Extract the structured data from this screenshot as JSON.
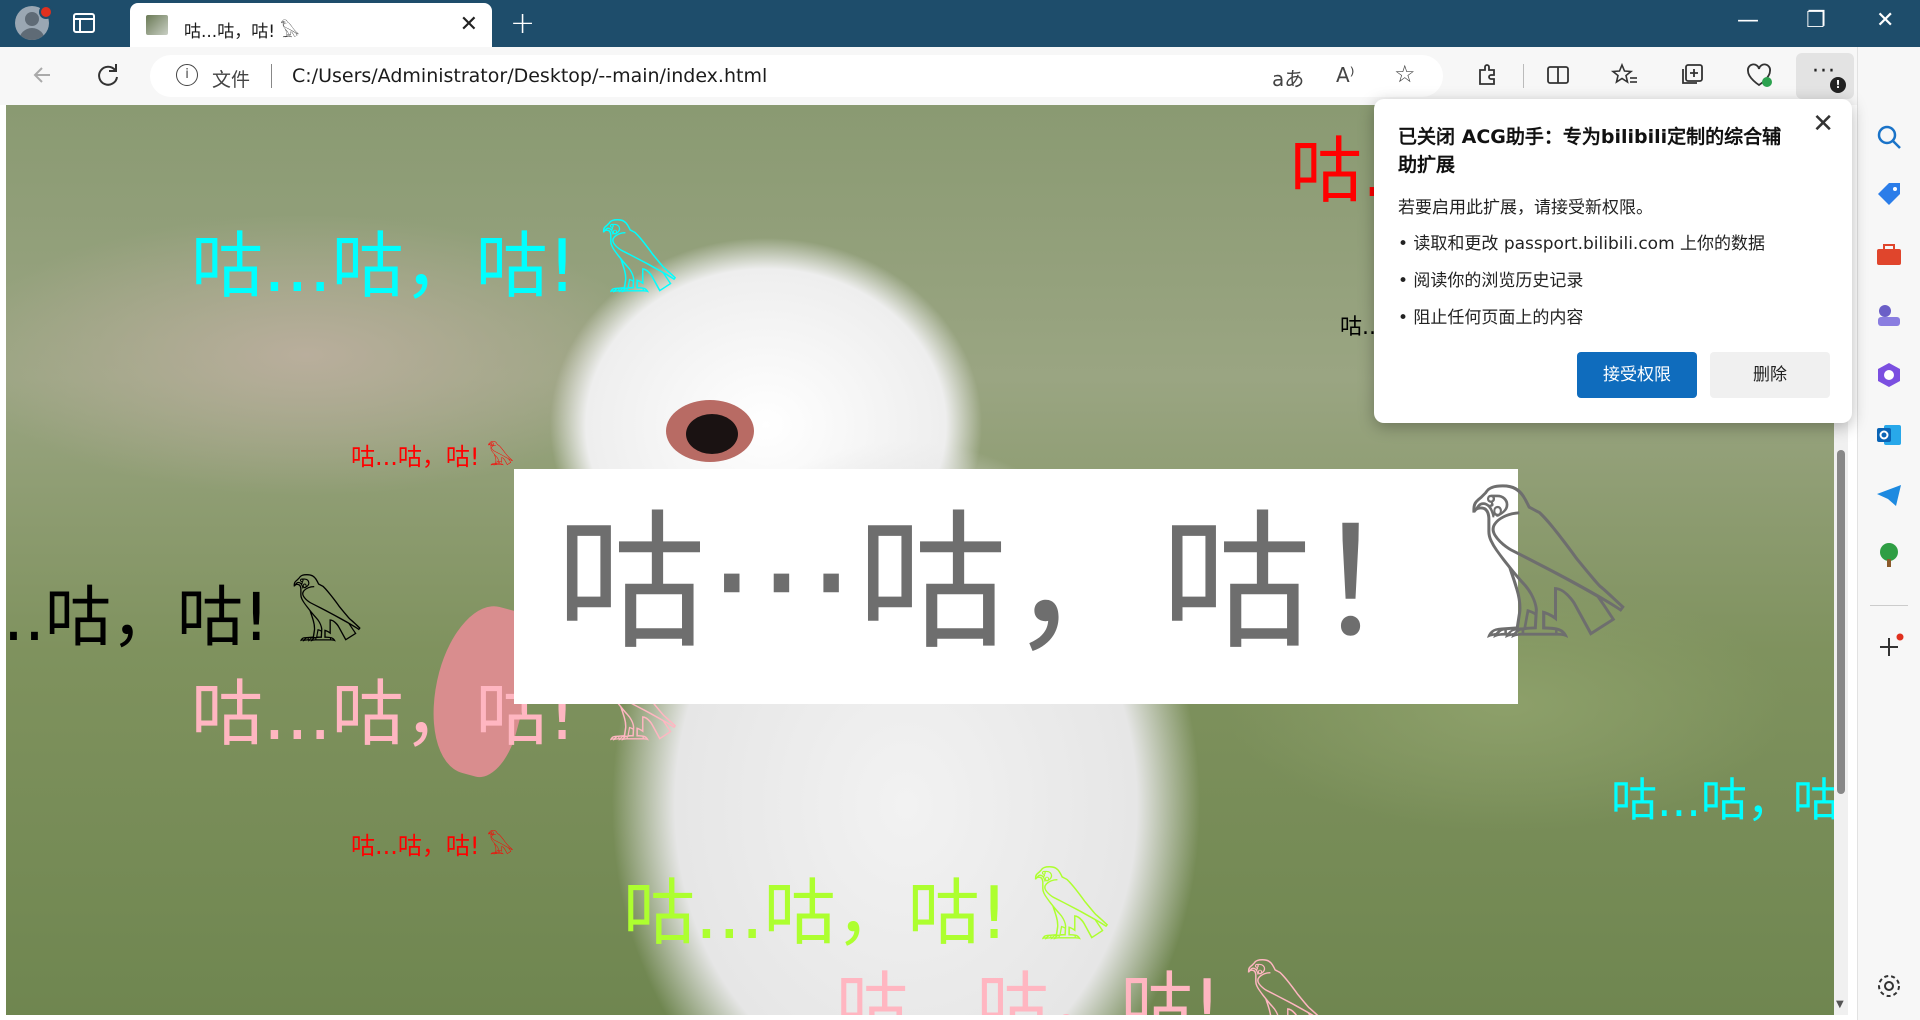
{
  "tab": {
    "title": "咕...咕，咕! 𓅃",
    "close": "✕"
  },
  "window": {
    "minimize": "—",
    "restore": "❐",
    "close": "✕",
    "new_tab": "+"
  },
  "address": {
    "info_icon": "i",
    "file_label": "文件",
    "url": "C:/Users/Administrator/Desktop/--main/index.html"
  },
  "toolbar": {
    "more": "···",
    "more_badge": "!"
  },
  "page": {
    "banner": "咕···咕，咕！𓅃",
    "danmu": [
      {
        "text": "咕...咕，咕! 𓅃",
        "color": "#00ffff"
      },
      {
        "text": "咕...咕，咕! 𓅃",
        "color": "#ff0000"
      },
      {
        "text": "咕...咕，咕! 𓅃",
        "color": "#000000"
      },
      {
        "text": "咕...咕，咕! 𓅃",
        "color": "#ffb6c1"
      },
      {
        "text": "咕...咕，咕! 𓅃",
        "color": "#ff0000"
      },
      {
        "text": "咕...咕，咕! 𓅃",
        "color": "#adff2f"
      },
      {
        "text": "咕...咕，咕! 𓅃",
        "color": "#ffb6c1"
      },
      {
        "text": "咕...咕，咕",
        "color": "#00ffff"
      },
      {
        "text": "咕.",
        "color": "#ff0000"
      },
      {
        "text": "咕..",
        "color": "#000000"
      }
    ]
  },
  "popup": {
    "title": "已关闭 ACG助手：专为bilibili定制的综合辅助扩展",
    "close": "✕",
    "description": "若要启用此扩展，请接受新权限。",
    "permissions": [
      "• 读取和更改 passport.bilibili.com 上你的数据",
      "• 阅读你的浏览历史记录",
      "• 阻止任何页面上的内容"
    ],
    "accept": "接受权限",
    "delete": "删除"
  }
}
